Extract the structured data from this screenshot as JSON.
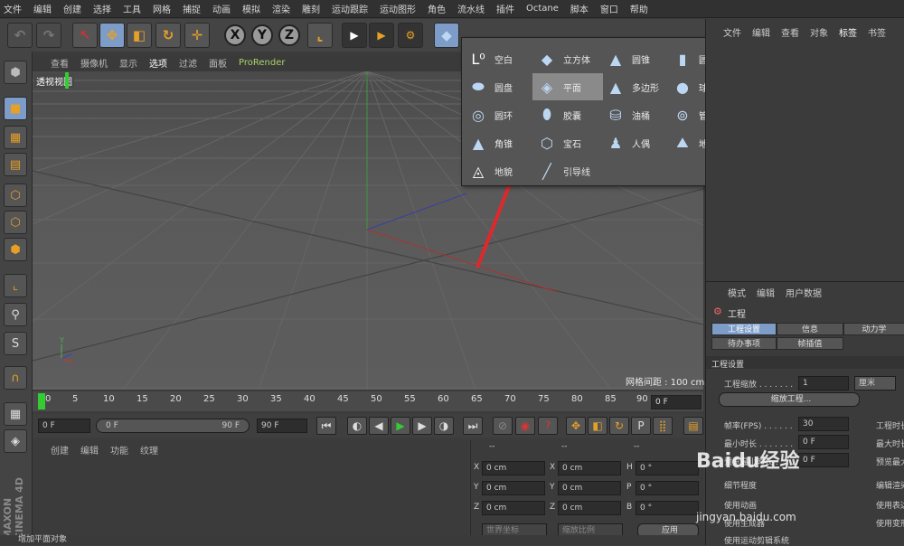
{
  "menu": [
    "文件",
    "编辑",
    "创建",
    "选择",
    "工具",
    "网格",
    "捕捉",
    "动画",
    "模拟",
    "渲染",
    "雕刻",
    "运动跟踪",
    "运动图形",
    "角色",
    "流水线",
    "插件",
    "Octane",
    "脚本",
    "窗口",
    "帮助"
  ],
  "viewport": {
    "menu": [
      "查看",
      "摄像机",
      "显示",
      "选项",
      "过滤",
      "面板",
      "ProRender"
    ],
    "label": "透视视图",
    "grid_info": "网格间距 : 100 cm"
  },
  "toolbar": {
    "x": "X",
    "y": "Y",
    "z": "Z"
  },
  "popup": {
    "items": [
      {
        "label": "空白",
        "icon": "null-icon"
      },
      {
        "label": "立方体",
        "icon": "cube-icon"
      },
      {
        "label": "圆锥",
        "icon": "cone-icon"
      },
      {
        "label": "圆柱",
        "icon": "cylinder-icon"
      },
      {
        "label": "圆盘",
        "icon": "disc-icon"
      },
      {
        "label": "平面",
        "icon": "plane-icon",
        "highlight": true
      },
      {
        "label": "多边形",
        "icon": "polygon-icon"
      },
      {
        "label": "球体",
        "icon": "sphere-icon"
      },
      {
        "label": "圆环",
        "icon": "torus-icon"
      },
      {
        "label": "胶囊",
        "icon": "capsule-icon"
      },
      {
        "label": "油桶",
        "icon": "oiltank-icon"
      },
      {
        "label": "管道",
        "icon": "tube-icon"
      },
      {
        "label": "角锥",
        "icon": "pyramid-icon"
      },
      {
        "label": "宝石",
        "icon": "gem-icon"
      },
      {
        "label": "人偶",
        "icon": "figure-icon"
      },
      {
        "label": "地形",
        "icon": "landscape-icon"
      },
      {
        "label": "地貌",
        "icon": "relief-icon"
      },
      {
        "label": "引导线",
        "icon": "guide-icon"
      }
    ]
  },
  "timeline": {
    "ticks": [
      "0",
      "5",
      "10",
      "15",
      "20",
      "25",
      "30",
      "35",
      "40",
      "45",
      "50",
      "55",
      "60",
      "65",
      "70",
      "75",
      "80",
      "85",
      "90"
    ],
    "current": "0 F",
    "start": "0 F",
    "range_start": "0 F",
    "range_end": "90 F",
    "end": "90 F"
  },
  "material": {
    "menu": [
      "创建",
      "编辑",
      "功能",
      "纹理"
    ]
  },
  "coords": {
    "header": [
      "--",
      "--",
      "--"
    ],
    "rows": [
      {
        "a": "X",
        "av": "0 cm",
        "b": "X",
        "bv": "0 cm",
        "c": "H",
        "cv": "0 °"
      },
      {
        "a": "Y",
        "av": "0 cm",
        "b": "Y",
        "bv": "0 cm",
        "c": "P",
        "cv": "0 °"
      },
      {
        "a": "Z",
        "av": "0 cm",
        "b": "Z",
        "bv": "0 cm",
        "c": "B",
        "cv": "0 °"
      }
    ],
    "world": "世界坐标",
    "scale": "缩放比例",
    "apply": "应用"
  },
  "objects": {
    "menu": [
      "文件",
      "编辑",
      "查看",
      "对象",
      "标签",
      "书签"
    ]
  },
  "attributes": {
    "menu": [
      "模式",
      "编辑",
      "用户数据"
    ],
    "title": "工程",
    "tabs": [
      "工程设置",
      "信息",
      "动力学",
      "待办事项",
      "帧插值"
    ],
    "section": "工程设置",
    "scale_label": "工程缩放 . . . . . . .",
    "scale_value": "1",
    "scale_unit": "厘米",
    "scale_button": "缩放工程...",
    "fps_label": "帧率(FPS) . . . . . .",
    "fps_value": "30",
    "min_label": "最小时长 . . . . . . .",
    "min_value": "0 F",
    "pre_label": "预览最小时长 . . . .",
    "pre_value": "0 F",
    "proj_label": "工程时长",
    "max_label": "最大时长",
    "premax_label": "预览最大",
    "lod_label": "细节程度",
    "use_anim": "使用动画",
    "use_gen": "使用生成器",
    "use_motion": "使用运动剪辑系统",
    "edit_render": "编辑渲染",
    "use_expr": "使用表达",
    "use_deform": "使用变形"
  },
  "brand": "MAXON CINEMA 4D",
  "status": "增加平面对象",
  "watermark": {
    "text": "Baidu经验",
    "url": "jingyan.baidu.com"
  }
}
